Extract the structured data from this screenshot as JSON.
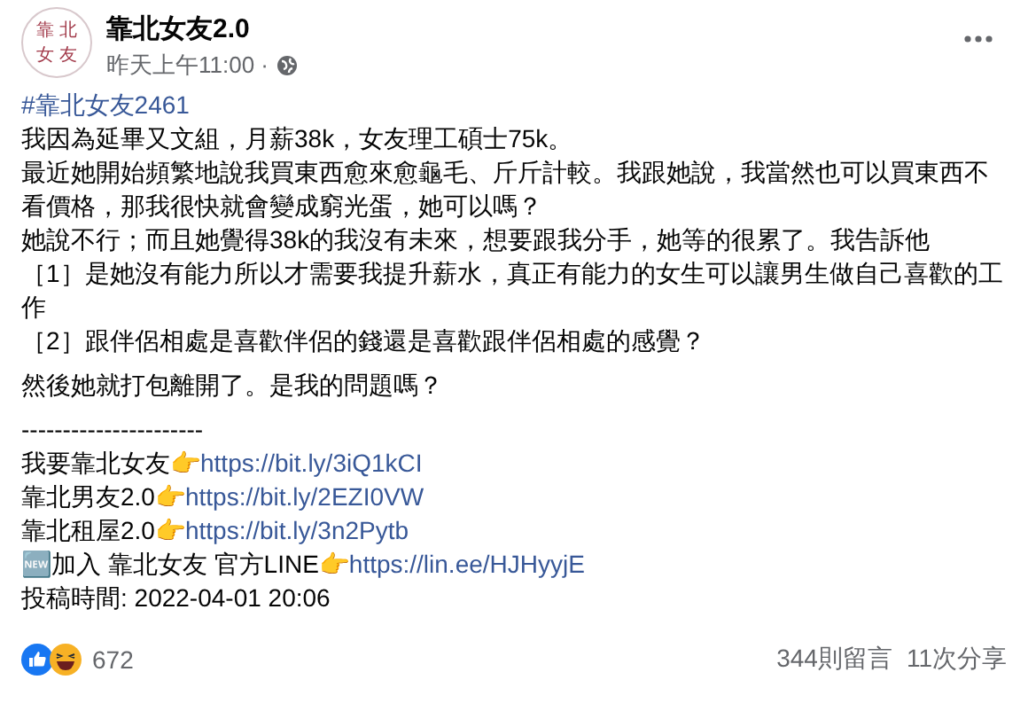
{
  "author": {
    "name": "靠北女友2.0",
    "avatar_text": [
      "靠",
      "北",
      "女",
      "友"
    ]
  },
  "time": "昨天上午11:00 ·",
  "hashtag": "#靠北女友2461",
  "blocks": [
    {
      "lines": [
        "我因為延畢又文組，月薪38k，女友理工碩士75k。",
        "最近她開始頻繁地說我買東西愈來愈龜毛、斤斤計較。我跟她說，我當然也可以買東西不看價格，那我很快就會變成窮光蛋，她可以嗎？",
        "她說不行；而且她覺得38k的我沒有未來，想要跟我分手，她等的很累了。我告訴他",
        "［1］是她沒有能力所以才需要我提升薪水，真正有能力的女生可以讓男生做自己喜歡的工作",
        "［2］跟伴侶相處是喜歡伴侶的錢還是喜歡跟伴侶相處的感覺？"
      ]
    },
    {
      "lines": [
        "然後她就打包離開了。是我的問題嗎？"
      ]
    }
  ],
  "separator": "----------------------",
  "links": [
    {
      "prefix": "我要靠北女友👉",
      "url": "https://bit.ly/3iQ1kCI"
    },
    {
      "prefix": "靠北男友2.0👉",
      "url": "https://bit.ly/2EZI0VW"
    },
    {
      "prefix": "靠北租屋2.0👉",
      "url": "https://bit.ly/3n2Pytb"
    },
    {
      "prefix": "🆕加入 靠北女友 官方LINE👉",
      "url": "https://lin.ee/HJHyyjE"
    }
  ],
  "posted": "投稿時間: 2022-04-01 20:06",
  "reactions": {
    "count": "672"
  },
  "comments": "344則留言",
  "shares": "11次分享"
}
